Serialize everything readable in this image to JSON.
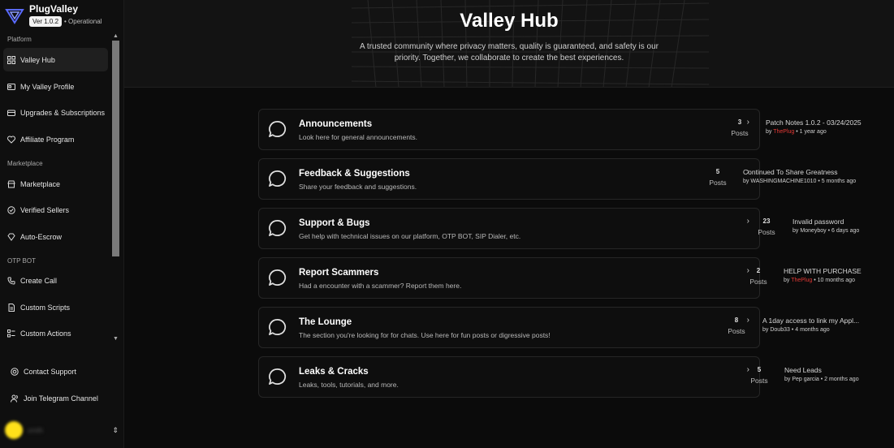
{
  "brand": {
    "name": "PlugValley",
    "version": "Ver 1.0.2",
    "status": "• Operational"
  },
  "sidebar": {
    "sections": [
      {
        "label": "Platform",
        "items": [
          {
            "label": "Valley Hub",
            "icon": "grid-icon",
            "active": true
          },
          {
            "label": "My Valley Profile",
            "icon": "id-card-icon"
          },
          {
            "label": "Upgrades & Subscriptions",
            "icon": "credit-card-icon"
          },
          {
            "label": "Affiliate Program",
            "icon": "heart-icon"
          }
        ]
      },
      {
        "label": "Marketplace",
        "items": [
          {
            "label": "Marketplace",
            "icon": "store-icon"
          },
          {
            "label": "Verified Sellers",
            "icon": "check-circle-icon"
          },
          {
            "label": "Auto-Escrow",
            "icon": "gem-icon"
          }
        ]
      },
      {
        "label": "OTP BOT",
        "items": [
          {
            "label": "Create Call",
            "icon": "phone-icon"
          },
          {
            "label": "Custom Scripts",
            "icon": "file-icon"
          },
          {
            "label": "Custom Actions",
            "icon": "list-icon"
          }
        ]
      }
    ],
    "bottom": [
      {
        "label": "Contact Support",
        "icon": "lifebuoy-icon"
      },
      {
        "label": "Join Telegram Channel",
        "icon": "users-icon"
      }
    ],
    "user": {
      "name": "smith",
      "avatar_color": "#ffe11a"
    }
  },
  "hero": {
    "title": "Valley Hub",
    "subtitle": "A trusted community where privacy matters, quality is guaranteed, and safety is our priority. Together, we collaborate to create the best experiences."
  },
  "forums": [
    {
      "title": "Announcements",
      "description": "Look here for general announcements.",
      "posts": "3",
      "posts_label": "Posts",
      "latest_title": "Patch Notes 1.0.2 - 03/24/2025",
      "latest_by": "by",
      "latest_author": "ThePlug",
      "author_highlight": true,
      "latest_time": "• 1 year ago"
    },
    {
      "title": "Feedback & Suggestions",
      "description": "Share your feedback and suggestions.",
      "posts": "5",
      "posts_label": "Posts",
      "latest_title": "Continued To Share Greatness",
      "latest_by": "by",
      "latest_author": "WASHINGMACHINE1010",
      "author_highlight": false,
      "latest_time": "• 5 months ago"
    },
    {
      "title": "Support & Bugs",
      "description": "Get help with technical issues on our platform, OTP BOT, SIP Dialer, etc.",
      "posts": "23",
      "posts_label": "Posts",
      "latest_title": "Invalid password",
      "latest_by": "by",
      "latest_author": "Moneyboy",
      "author_highlight": false,
      "latest_time": "• 6 days ago"
    },
    {
      "title": "Report Scammers",
      "description": "Had a encounter with a scammer? Report them here.",
      "posts": "2",
      "posts_label": "Posts",
      "latest_title": "HELP WITH PURCHASE",
      "latest_by": "by",
      "latest_author": "ThePlug",
      "author_highlight": true,
      "latest_time": "• 10 months ago"
    },
    {
      "title": "The Lounge",
      "description": "The section you're looking for for chats. Use here for fun posts or digressive posts!",
      "posts": "8",
      "posts_label": "Posts",
      "latest_title": "A 1day access to link my Appl...",
      "latest_by": "by",
      "latest_author": "Doub33",
      "author_highlight": false,
      "latest_time": "• 4 months ago"
    },
    {
      "title": "Leaks & Cracks",
      "description": "Leaks, tools, tutorials, and more.",
      "posts": "5",
      "posts_label": "Posts",
      "latest_title": "Need Leads",
      "latest_by": "by",
      "latest_author": "Pep garcia",
      "author_highlight": false,
      "latest_time": "• 2 months ago"
    }
  ],
  "colors": {
    "accent_red": "#e53935",
    "background": "#0b0b0b",
    "card_border": "#262626"
  }
}
